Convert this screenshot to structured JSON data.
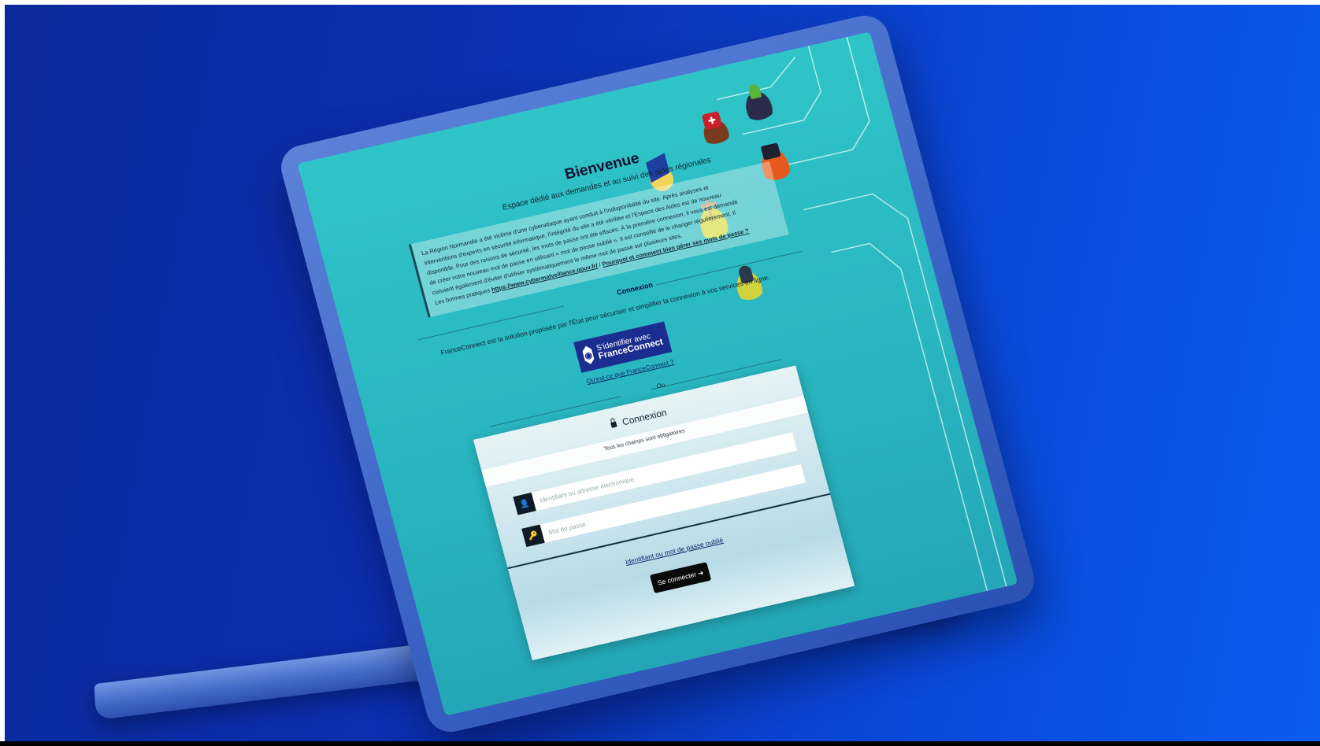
{
  "page": {
    "title": "Bienvenue",
    "subtitle": "Espace dédié aux demandes et au suivi des aides régionales"
  },
  "notice": {
    "line1": "La Région Normandie a été victime d'une cyberattaque ayant conduit à l'indisponibilité du site. Après analyses et",
    "line2": "interventions d'experts en sécurité informatique, l'intégrité du site a été vérifiée et l'Espace des Aides est de nouveau",
    "line3": "disponible. Pour des raisons de sécurité, les mots de passe ont été effacés. À la première connexion, il vous est demandé",
    "line4": "de créer votre nouveau mot de passe en utilisant « mot de passe oublié ». Il est conseillé de le changer régulièrement. Il",
    "line5": "convient également d'éviter d'utiliser systématiquement le même mot de passe sur plusieurs sites.",
    "line6_prefix": "Les bonnes pratiques",
    "link1": "https://www.cybermalveillance.gouv.fr/",
    "link2": "Pourquoi et comment bien gérer ses mots de passe ?"
  },
  "franceconnect": {
    "section_label": "Connexion",
    "description": "FranceConnect est la solution proposée par l'État pour sécuriser et simplifier la connexion à vos services en ligne.",
    "button_line1": "S'identifier avec",
    "button_line2": "FranceConnect",
    "help_link": "Qu'est-ce que FranceConnect ?"
  },
  "separator": {
    "or_label": "Ou"
  },
  "login": {
    "header": "Connexion",
    "required_note": "Tous les champs sont obligatoires",
    "username_placeholder": "Identifiant ou adresse électronique",
    "password_placeholder": "Mot de passe",
    "forgot_link": "Identifiant ou mot de passe oublié",
    "submit_label": "Se connecter"
  },
  "colors": {
    "background": "#0b2fb0",
    "screen": "#2fc4c8",
    "franceconnect": "#1b2d8f",
    "submit": "#0a0a0a"
  }
}
